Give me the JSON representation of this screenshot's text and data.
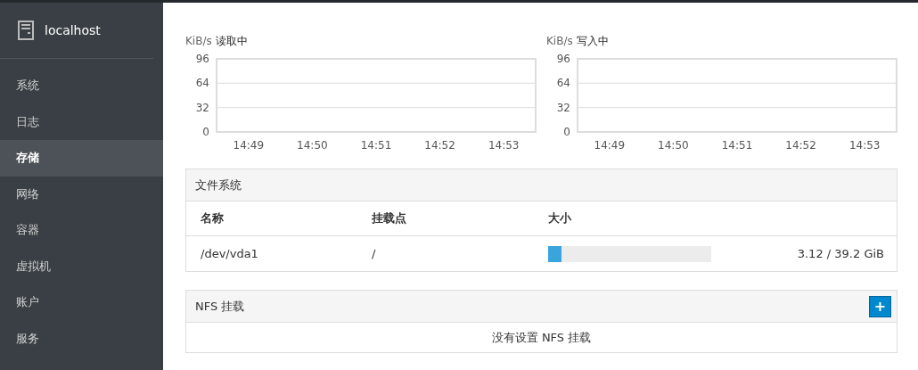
{
  "sidebar": {
    "host": "localhost",
    "items": [
      {
        "label": "系统",
        "selected": false
      },
      {
        "label": "日志",
        "selected": false
      },
      {
        "label": "存储",
        "selected": true
      },
      {
        "label": "网络",
        "selected": false
      },
      {
        "label": "容器",
        "selected": false
      },
      {
        "label": "虚拟机",
        "selected": false
      },
      {
        "label": "账户",
        "selected": false
      },
      {
        "label": "服务",
        "selected": false
      }
    ]
  },
  "charts": [
    {
      "chart_data": {
        "type": "line",
        "title": "读取中",
        "ylabel": "KiB/s",
        "categories": [
          "14:49",
          "14:50",
          "14:51",
          "14:52",
          "14:53"
        ],
        "ylim": [
          0,
          96
        ],
        "yticks": [
          0,
          32,
          64,
          96
        ]
      }
    },
    {
      "chart_data": {
        "type": "line",
        "title": "写入中",
        "ylabel": "KiB/s",
        "categories": [
          "14:49",
          "14:50",
          "14:51",
          "14:52",
          "14:53"
        ],
        "ylim": [
          0,
          96
        ],
        "yticks": [
          0,
          32,
          64,
          96
        ]
      }
    }
  ],
  "filesystems": {
    "title": "文件系统",
    "columns": [
      "名称",
      "挂载点",
      "大小"
    ],
    "rows": [
      {
        "name": "/dev/vda1",
        "mount": "/",
        "level": 0.08,
        "size": "3.12 / 39.2 GiB"
      }
    ]
  },
  "nfs": {
    "title": "NFS 挂载",
    "add_button": "+",
    "empty": "没有设置 NFS 挂载"
  }
}
